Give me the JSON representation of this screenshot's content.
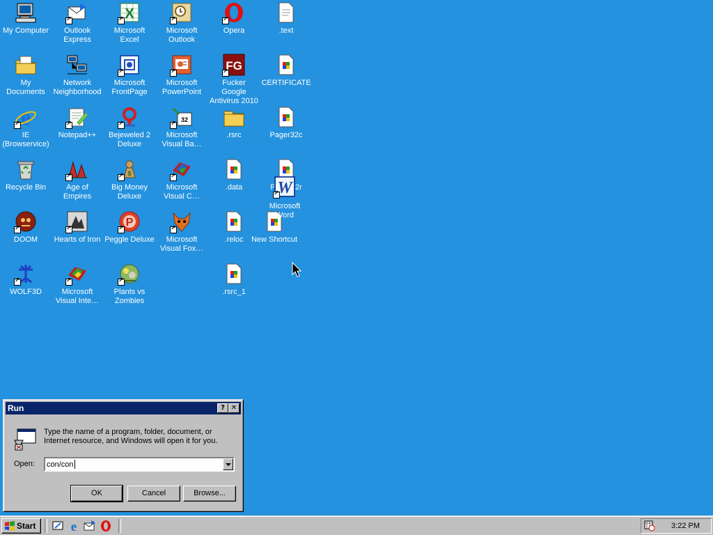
{
  "desktop": {
    "icons": [
      {
        "label": "My Computer",
        "icon": "computer-icon"
      },
      {
        "label": "Outlook Express",
        "icon": "outlook-express-icon"
      },
      {
        "label": "Microsoft Excel",
        "icon": "excel-icon"
      },
      {
        "label": "Microsoft Outlook",
        "icon": "outlook-icon"
      },
      {
        "label": "Opera",
        "icon": "opera-icon"
      },
      {
        "label": ".text",
        "icon": "file-icon"
      },
      {
        "label": "My Documents",
        "icon": "folder-documents-icon"
      },
      {
        "label": "Network Neighborhood",
        "icon": "network-icon"
      },
      {
        "label": "Microsoft FrontPage",
        "icon": "frontpage-icon"
      },
      {
        "label": "Microsoft PowerPoint",
        "icon": "powerpoint-icon"
      },
      {
        "label": "Fucker Google Antivirus 2010",
        "icon": "antivirus-icon"
      },
      {
        "label": "CERTIFICATE",
        "icon": "file-icon"
      },
      {
        "label": "IE (Browservice)",
        "icon": "ie-icon"
      },
      {
        "label": "Notepad++",
        "icon": "notepad-icon"
      },
      {
        "label": "Bejeweled 2 Deluxe",
        "icon": "bejeweled-icon"
      },
      {
        "label": "Microsoft Visual Ba…",
        "icon": "visual-basic-icon"
      },
      {
        "label": ".rsrc",
        "icon": "folder-icon"
      },
      {
        "label": "Pager32c",
        "icon": "file-icon"
      },
      {
        "label": "Recycle Bin",
        "icon": "recycle-bin-icon"
      },
      {
        "label": "Age of Empires",
        "icon": "age-of-empires-icon"
      },
      {
        "label": "Big Money Deluxe",
        "icon": "big-money-icon"
      },
      {
        "label": "Microsoft Visual C…",
        "icon": "visual-c-icon"
      },
      {
        "label": ".data",
        "icon": "file-icon"
      },
      {
        "label": "Pager32r",
        "icon": "file-icon"
      },
      {
        "label": "DOOM",
        "icon": "doom-icon"
      },
      {
        "label": "Hearts of Iron",
        "icon": "hearts-of-iron-icon"
      },
      {
        "label": "Peggle Deluxe",
        "icon": "peggle-icon"
      },
      {
        "label": "Microsoft Visual Fox…",
        "icon": "visual-foxpro-icon"
      },
      {
        "label": ".reloc",
        "icon": "file-icon"
      },
      {
        "label": "New Shortcut",
        "icon": "file-icon"
      },
      {
        "label": "WOLF3D",
        "icon": "wolf3d-icon"
      },
      {
        "label": "Microsoft Visual Inte…",
        "icon": "visual-interdev-icon"
      },
      {
        "label": "Plants vs Zombies",
        "icon": "plants-vs-zombies-icon"
      },
      {
        "label": ".rsrc_1",
        "icon": "file-icon"
      }
    ],
    "dragging": {
      "label": "Microsoft Word",
      "icon": "word-icon"
    }
  },
  "run_dialog": {
    "title": "Run",
    "help_button": "?",
    "close_button": "✕",
    "description": "Type the name of a program, folder, document, or Internet resource, and Windows will open it for you.",
    "open_label": "Open:",
    "open_value": "con/con",
    "ok_label": "OK",
    "cancel_label": "Cancel",
    "browse_label": "Browse..."
  },
  "taskbar": {
    "start_label": "Start",
    "quick_launch": [
      "show-desktop-icon",
      "ie-icon",
      "outlook-express-icon",
      "opera-icon"
    ],
    "tray_icon": "scheduler-icon",
    "clock": "3:22 PM"
  },
  "colors": {
    "desktop": "#2492de",
    "titlebar": "#0a246a",
    "face": "#c0c0c0"
  }
}
